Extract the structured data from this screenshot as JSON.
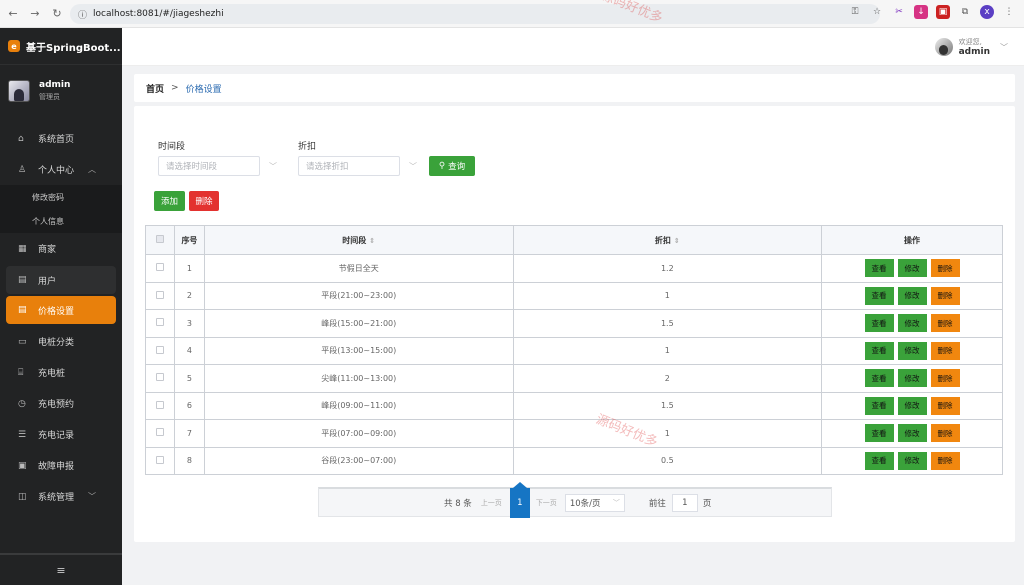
{
  "browser": {
    "url": "localhost:8081/#/jiageshezhi"
  },
  "sidebar": {
    "app_title": "基于SpringBoot...",
    "user_name": "admin",
    "user_role": "管理员",
    "items": [
      {
        "label": "系统首页",
        "icon": "home-icon"
      },
      {
        "label": "个人中心",
        "icon": "user-icon"
      },
      {
        "label": "商家",
        "icon": "grid-icon"
      },
      {
        "label": "用户",
        "icon": "save-icon"
      },
      {
        "label": "价格设置",
        "icon": "save-icon"
      },
      {
        "label": "电桩分类",
        "icon": "monitor-icon"
      },
      {
        "label": "充电桩",
        "icon": "charger-icon"
      },
      {
        "label": "充电预约",
        "icon": "clock-icon"
      },
      {
        "label": "充电记录",
        "icon": "database-icon"
      },
      {
        "label": "故障申报",
        "icon": "inbox-icon"
      },
      {
        "label": "系统管理",
        "icon": "book-icon"
      }
    ],
    "sub_items": [
      "修改密码",
      "个人信息"
    ]
  },
  "topbar": {
    "welcome": "欢迎您,",
    "user": "admin"
  },
  "breadcrumb": {
    "home": "首页",
    "separator": ">",
    "current": "价格设置"
  },
  "filters": {
    "period_label": "时间段",
    "period_placeholder": "请选择时间段",
    "discount_label": "折扣",
    "discount_placeholder": "请选择折扣",
    "search_button": "查询"
  },
  "actions": {
    "add": "添加",
    "delete": "删除"
  },
  "table": {
    "headers": [
      "序号",
      "时间段",
      "折扣",
      "操作"
    ],
    "op_labels": {
      "view": "查看",
      "edit": "修改",
      "delete": "删除"
    },
    "rows": [
      {
        "no": "1",
        "period": "节假日全天",
        "discount": "1.2"
      },
      {
        "no": "2",
        "period": "平段(21:00~23:00)",
        "discount": "1"
      },
      {
        "no": "3",
        "period": "峰段(15:00~21:00)",
        "discount": "1.5"
      },
      {
        "no": "4",
        "period": "平段(13:00~15:00)",
        "discount": "1"
      },
      {
        "no": "5",
        "period": "尖峰(11:00~13:00)",
        "discount": "2"
      },
      {
        "no": "6",
        "period": "峰段(09:00~11:00)",
        "discount": "1.5"
      },
      {
        "no": "7",
        "period": "平段(07:00~09:00)",
        "discount": "1"
      },
      {
        "no": "8",
        "period": "谷段(23:00~07:00)",
        "discount": "0.5"
      }
    ]
  },
  "pagination": {
    "total": "共 8 条",
    "prev": "上一页",
    "current": "1",
    "next": "下一页",
    "page_size": "10条/页",
    "goto": "前往",
    "goto_value": "1",
    "page_unit": "页"
  },
  "watermark": "源码好优多",
  "colors": {
    "accent": "#e8800c",
    "sidebar_bg": "#222324",
    "green": "#3aa23a",
    "red": "#e3322f",
    "orange": "#f1870f",
    "pager_blue": "#1675c4"
  }
}
